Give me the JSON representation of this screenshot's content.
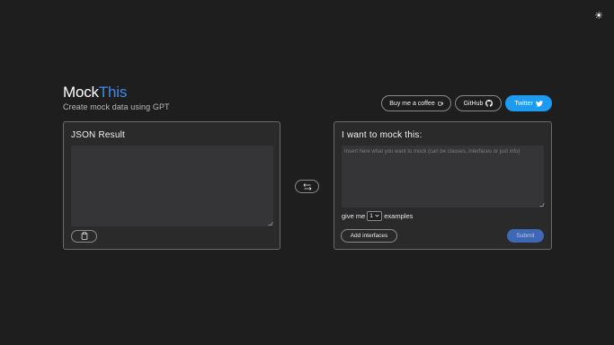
{
  "theme_toggle": {
    "icon": "sun-icon",
    "glyph": "☀"
  },
  "brand": {
    "title_part1": "Mock",
    "title_part2": "This",
    "subtitle": "Create mock data using GPT",
    "accent_color": "#3d8af0"
  },
  "top_buttons": {
    "coffee": {
      "label": "Buy me a coffee",
      "icon": "coffee-icon"
    },
    "github": {
      "label": "GitHub",
      "icon": "github-icon"
    },
    "twitter": {
      "label": "Twitter",
      "icon": "twitter-bird-icon",
      "color": "#1d9bf0"
    }
  },
  "result_panel": {
    "title": "JSON Result",
    "value": "",
    "copy_icon": "clipboard-icon"
  },
  "swap": {
    "icon": "swap-arrows-icon"
  },
  "input_panel": {
    "title": "I want to mock this:",
    "placeholder": "Insert here what you want to mock (can be classes, interfaces or just info)",
    "give_me_label": "give me",
    "count_value": "1",
    "examples_label": "examples",
    "add_interfaces_label": "Add interfaces",
    "submit_label": "Submit",
    "submit_color": "#3f68b4"
  }
}
